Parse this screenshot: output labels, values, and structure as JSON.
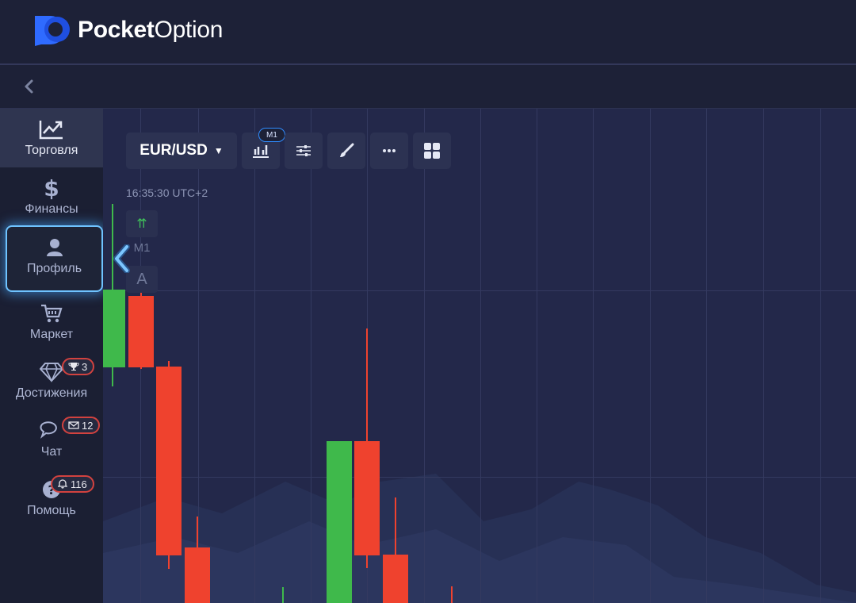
{
  "brand": {
    "name_bold": "Pocket",
    "name_light": "Option"
  },
  "sidebar": {
    "items": [
      {
        "label": "Торговля",
        "icon": "trend-chart-icon",
        "state": "active"
      },
      {
        "label": "Финансы",
        "icon": "dollar-icon"
      },
      {
        "label": "Профиль",
        "icon": "user-icon",
        "state": "focused"
      },
      {
        "label": "Маркет",
        "icon": "cart-icon"
      },
      {
        "label": "Достижения",
        "icon": "diamond-icon",
        "badge": "3",
        "badge_icon": "trophy-icon"
      },
      {
        "label": "Чат",
        "icon": "chat-icon",
        "badge": "12",
        "badge_icon": "mail-icon"
      },
      {
        "label": "Помощь",
        "icon": "help-icon",
        "badge": "116",
        "badge_icon": "bell-icon"
      }
    ]
  },
  "toolbar": {
    "pair": "EUR/USD",
    "timeframe": "M1",
    "buttons": [
      "chart-type-icon",
      "settings-sliders-icon",
      "drawing-brush-icon",
      "more-dots-icon",
      "layout-grid-icon"
    ]
  },
  "chart": {
    "time_label": "16:35:30 UTC+2",
    "mini_timeframe": "M1",
    "mini_letter": "A",
    "up_color": "#3fb94b",
    "down_color": "#ef422e"
  },
  "colors": {
    "accent": "#2f8cff",
    "badge_border": "#d2423f",
    "background": "#1d2137"
  }
}
